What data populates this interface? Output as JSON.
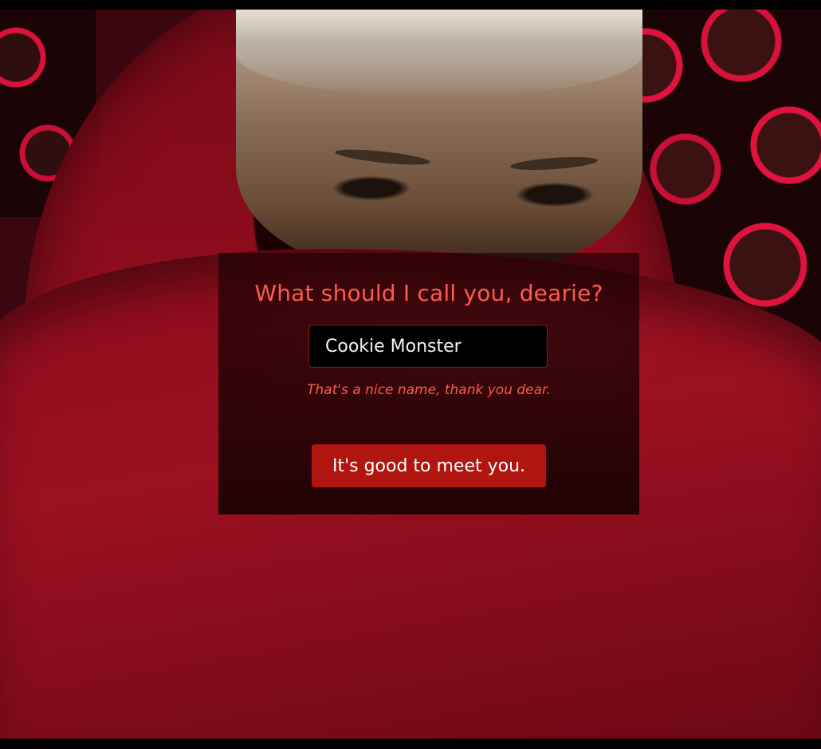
{
  "dialog": {
    "title": "What should I call you, dearie?",
    "name_value": "Cookie Monster",
    "helper_text": "That's a nice name, thank you dear.",
    "confirm_label": "It's good to meet you."
  },
  "colors": {
    "accent_text": "#ff5a4a",
    "button_bg": "#b0160f",
    "input_border": "#8a1a14"
  }
}
